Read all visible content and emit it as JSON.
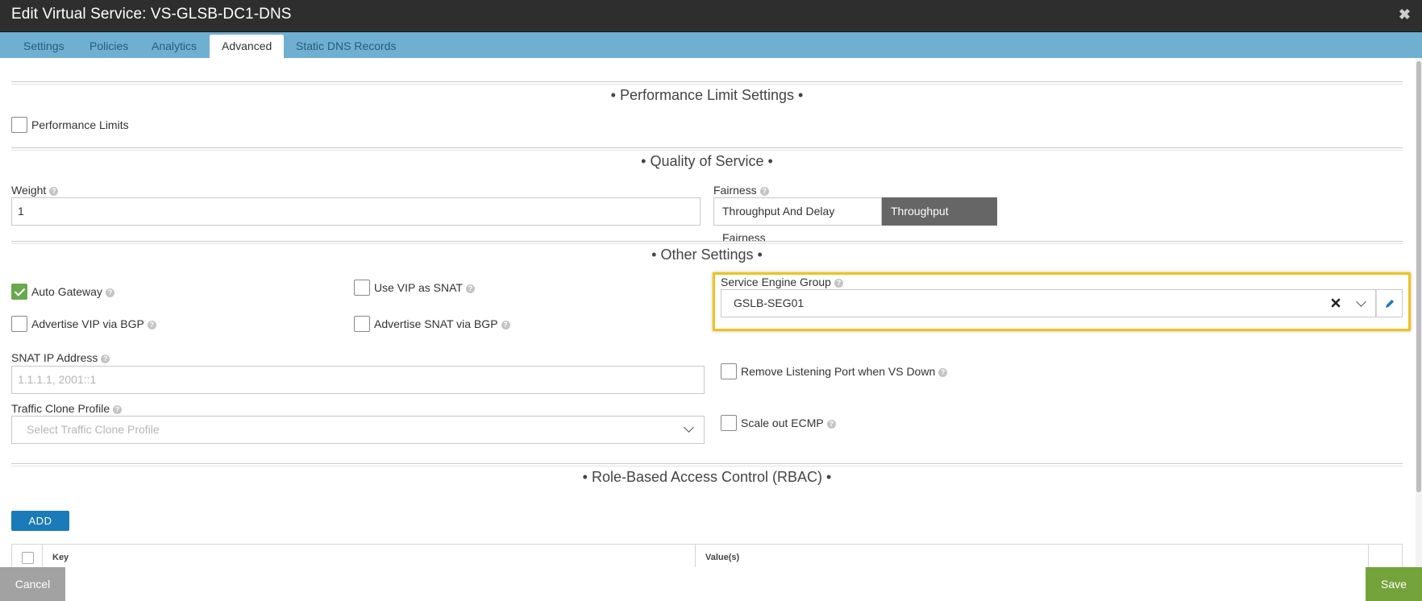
{
  "window": {
    "title": "Edit Virtual Service: VS-GLSB-DC1-DNS",
    "close_glyph": "✖"
  },
  "tabs": [
    {
      "label": "Settings",
      "active": false
    },
    {
      "label": "Policies",
      "active": false
    },
    {
      "label": "Analytics",
      "active": false
    },
    {
      "label": "Advanced",
      "active": true
    },
    {
      "label": "Static DNS Records",
      "active": false
    }
  ],
  "performance": {
    "section_title": "• Performance Limit Settings •",
    "limits_label": "Performance Limits",
    "limits_checked": false
  },
  "qos": {
    "section_title": "• Quality of Service •",
    "weight_label": "Weight",
    "weight_value": "1",
    "fairness_label": "Fairness",
    "fairness_options": [
      "Throughput And Delay Fairness",
      "Throughput Fairness"
    ],
    "fairness_selected": "Throughput Fairness"
  },
  "other": {
    "section_title": "• Other Settings •",
    "auto_gateway_label": "Auto Gateway",
    "auto_gateway_checked": true,
    "use_vip_snat_label": "Use VIP as SNAT",
    "advertise_vip_label": "Advertise VIP via BGP",
    "advertise_snat_label": "Advertise SNAT via BGP",
    "seg_label": "Service Engine Group",
    "seg_value": "GSLB-SEG01",
    "snat_ip_label": "SNAT IP Address",
    "snat_ip_placeholder": "1.1.1.1, 2001::1",
    "remove_port_label": "Remove Listening Port when VS Down",
    "traffic_clone_label": "Traffic Clone Profile",
    "traffic_clone_placeholder": "Select Traffic Clone Profile",
    "scale_out_label": "Scale out ECMP",
    "help_glyph": "?"
  },
  "rbac": {
    "section_title": "• Role-Based Access Control (RBAC) •",
    "add_label": "ADD",
    "columns": [
      "Key",
      "Value(s)"
    ]
  },
  "footer": {
    "cancel_label": "Cancel",
    "save_label": "Save"
  },
  "colors": {
    "title_bg": "#2e2e2e",
    "tab_bar": "#6fb0d1",
    "highlight": "#f1c21b",
    "save": "#75a33b",
    "add": "#1b7ab8"
  },
  "icons": [
    "close-icon",
    "help-icon",
    "check-icon",
    "clear-icon",
    "chevron-down-icon",
    "pencil-icon"
  ]
}
